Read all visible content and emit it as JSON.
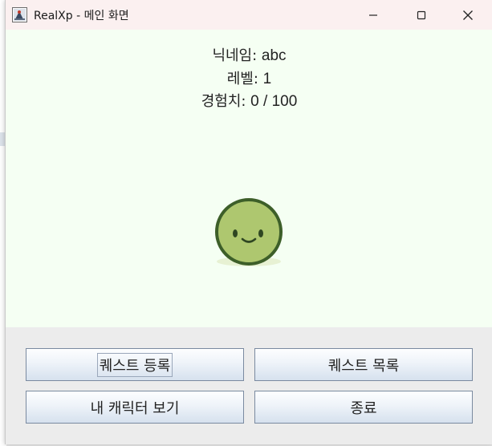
{
  "window": {
    "title": "RealXp - 메인 화면",
    "controls": {
      "minimize_icon": "minimize-icon",
      "maximize_icon": "maximize-icon",
      "close_icon": "close-icon"
    }
  },
  "profile": {
    "nickname_label": "닉네임: ",
    "nickname_value": "abc",
    "level_label": "레벨: ",
    "level_value": "1",
    "xp_label": "경험치: ",
    "xp_value": "0 / 100"
  },
  "character": {
    "icon": "smiling-green-blob-character",
    "body_color": "#aec76f",
    "outline_color": "#3d5f29"
  },
  "buttons": {
    "register_quest": "퀘스트 등록",
    "quest_list": "퀘스트 목록",
    "view_character": "내 캐릭터 보기",
    "exit": "종료"
  },
  "colors": {
    "content_bg": "#f5fff3",
    "titlebar_bg": "#fbf0f0",
    "panel_bg": "#ececec"
  }
}
